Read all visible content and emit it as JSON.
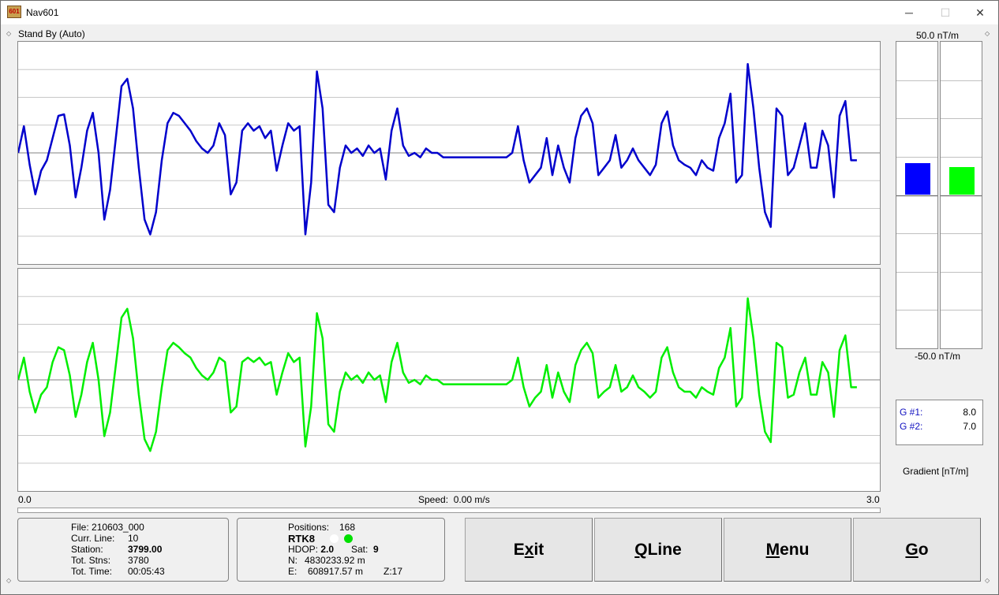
{
  "window": {
    "title": "Nav601",
    "icon": "nav601-app-icon",
    "icon_text": "601",
    "controls": {
      "minimize": "─",
      "maximize": "☐",
      "close": "✕"
    }
  },
  "status": {
    "mode": "Stand By (Auto)"
  },
  "x_axis": {
    "left": "0.0",
    "right": "3.0"
  },
  "speed": {
    "label": "Speed:",
    "value": "0.00 m/s"
  },
  "progress": {
    "fraction": 0
  },
  "gauges": {
    "top_label": "50.0 nT/m",
    "bottom_label": "-50.0 nT/m",
    "g1": {
      "color": "#0000ff",
      "value": 8.0
    },
    "g2": {
      "color": "#00ff00",
      "value": 7.0
    }
  },
  "readout": {
    "g1_label": "G #1:",
    "g1_value": "8.0",
    "g2_label": "G #2:",
    "g2_value": "7.0"
  },
  "gradient_label": "Gradient [nT/m]",
  "file_panel": {
    "file_label": "File:",
    "file_value": "210603_000",
    "line_label": "Curr. Line:",
    "line_value": "10",
    "station_label": "Station:",
    "station_value": "3799.00",
    "stns_label": "Tot. Stns:",
    "stns_value": "3780",
    "time_label": "Tot. Time:",
    "time_value": "00:05:43"
  },
  "gps_panel": {
    "positions_label": "Positions:",
    "positions_value": "168",
    "fix": "RTK8",
    "status_dots": [
      "#ffffff",
      "#00e000"
    ],
    "hdop_label": "HDOP:",
    "hdop_value": "2.0",
    "sat_label": "Sat:",
    "sat_value": "9",
    "n_label": "N:",
    "n_value": "4830233.92 m",
    "e_label": "E:",
    "e_value": "608917.57 m",
    "z_value": "Z:17"
  },
  "buttons": [
    {
      "pre": "E",
      "key": "x",
      "post": "it"
    },
    {
      "pre": "",
      "key": "Q",
      "post": "Line"
    },
    {
      "pre": "",
      "key": "M",
      "post": "enu"
    },
    {
      "pre": "",
      "key": "G",
      "post": "o"
    }
  ],
  "colors": {
    "trace1": "#0000cc",
    "trace2": "#00ee00"
  },
  "chart_data": [
    {
      "type": "line",
      "name": "gradiometer-1-trace",
      "x": [
        0,
        0.02,
        0.04,
        0.06,
        0.08,
        0.1,
        0.12,
        0.14,
        0.16,
        0.18,
        0.2,
        0.22,
        0.24,
        0.26,
        0.28,
        0.3,
        0.32,
        0.34,
        0.36,
        0.38,
        0.4,
        0.42,
        0.44,
        0.46,
        0.48,
        0.5,
        0.52,
        0.54,
        0.56,
        0.58,
        0.6,
        0.62,
        0.64,
        0.66,
        0.68,
        0.7,
        0.72,
        0.74,
        0.76,
        0.78,
        0.8,
        0.82,
        0.84,
        0.86,
        0.88,
        0.9,
        0.92,
        0.94,
        0.96,
        0.98,
        1.0,
        1.02,
        1.04,
        1.06,
        1.08,
        1.1,
        1.12,
        1.14,
        1.16,
        1.18,
        1.2,
        1.22,
        1.24,
        1.26,
        1.28,
        1.3,
        1.32,
        1.34,
        1.36,
        1.38,
        1.4,
        1.42,
        1.44,
        1.46,
        1.48,
        1.5,
        1.52,
        1.54,
        1.56,
        1.58,
        1.6,
        1.62,
        1.64,
        1.66,
        1.68,
        1.7,
        1.72,
        1.74,
        1.76,
        1.78,
        1.8,
        1.82,
        1.84,
        1.86,
        1.88,
        1.9,
        1.92,
        1.94,
        1.96,
        1.98,
        2.0,
        2.02,
        2.04,
        2.06,
        2.08,
        2.1,
        2.12,
        2.14,
        2.16,
        2.18,
        2.2,
        2.22,
        2.24,
        2.26,
        2.28,
        2.3,
        2.32,
        2.34,
        2.36,
        2.38,
        2.4,
        2.42,
        2.44,
        2.46,
        2.48,
        2.5,
        2.52,
        2.54,
        2.56,
        2.58,
        2.6,
        2.62,
        2.64,
        2.66,
        2.68,
        2.7,
        2.72,
        2.74,
        2.76,
        2.78,
        2.8,
        2.82,
        2.84,
        2.86,
        2.88,
        2.9,
        2.92,
        2.94,
        2.96,
        2.98,
        3.0
      ],
      "y": [
        0,
        18,
        -8,
        -28,
        -12,
        -5,
        10,
        25,
        26,
        5,
        -30,
        -10,
        15,
        27,
        0,
        -45,
        -25,
        10,
        45,
        50,
        30,
        -10,
        -45,
        -55,
        -40,
        -5,
        20,
        27,
        25,
        20,
        15,
        8,
        3,
        0,
        5,
        20,
        12,
        -28,
        -20,
        15,
        20,
        15,
        18,
        10,
        15,
        -12,
        5,
        20,
        15,
        18,
        -55,
        -20,
        55,
        30,
        -35,
        -40,
        -10,
        5,
        0,
        3,
        -2,
        5,
        0,
        3,
        -18,
        15,
        30,
        5,
        -2,
        0,
        -3,
        3,
        0,
        0,
        -3,
        -3,
        -3,
        -3,
        -3,
        -3,
        -3,
        -3,
        -3,
        -3,
        -3,
        -3,
        0,
        18,
        -5,
        -20,
        -15,
        -10,
        10,
        -15,
        5,
        -10,
        -20,
        10,
        25,
        30,
        20,
        -15,
        -10,
        -5,
        12,
        -10,
        -5,
        3,
        -5,
        -10,
        -15,
        -8,
        20,
        28,
        5,
        -5,
        -8,
        -10,
        -15,
        -5,
        -10,
        -12,
        10,
        20,
        40,
        -20,
        -15,
        60,
        30,
        -10,
        -40,
        -50,
        30,
        25,
        -15,
        -10,
        5,
        20,
        -10,
        -10,
        15,
        5,
        -30,
        25,
        35,
        -5,
        -5
      ],
      "ylim": [
        -75,
        75
      ]
    },
    {
      "type": "line",
      "name": "gradiometer-2-trace",
      "x": [
        0,
        0.02,
        0.04,
        0.06,
        0.08,
        0.1,
        0.12,
        0.14,
        0.16,
        0.18,
        0.2,
        0.22,
        0.24,
        0.26,
        0.28,
        0.3,
        0.32,
        0.34,
        0.36,
        0.38,
        0.4,
        0.42,
        0.44,
        0.46,
        0.48,
        0.5,
        0.52,
        0.54,
        0.56,
        0.58,
        0.6,
        0.62,
        0.64,
        0.66,
        0.68,
        0.7,
        0.72,
        0.74,
        0.76,
        0.78,
        0.8,
        0.82,
        0.84,
        0.86,
        0.88,
        0.9,
        0.92,
        0.94,
        0.96,
        0.98,
        1.0,
        1.02,
        1.04,
        1.06,
        1.08,
        1.1,
        1.12,
        1.14,
        1.16,
        1.18,
        1.2,
        1.22,
        1.24,
        1.26,
        1.28,
        1.3,
        1.32,
        1.34,
        1.36,
        1.38,
        1.4,
        1.42,
        1.44,
        1.46,
        1.48,
        1.5,
        1.52,
        1.54,
        1.56,
        1.58,
        1.6,
        1.62,
        1.64,
        1.66,
        1.68,
        1.7,
        1.72,
        1.74,
        1.76,
        1.78,
        1.8,
        1.82,
        1.84,
        1.86,
        1.88,
        1.9,
        1.92,
        1.94,
        1.96,
        1.98,
        2.0,
        2.02,
        2.04,
        2.06,
        2.08,
        2.1,
        2.12,
        2.14,
        2.16,
        2.18,
        2.2,
        2.22,
        2.24,
        2.26,
        2.28,
        2.3,
        2.32,
        2.34,
        2.36,
        2.38,
        2.4,
        2.42,
        2.44,
        2.46,
        2.48,
        2.5,
        2.52,
        2.54,
        2.56,
        2.58,
        2.6,
        2.62,
        2.64,
        2.66,
        2.68,
        2.7,
        2.72,
        2.74,
        2.76,
        2.78,
        2.8,
        2.82,
        2.84,
        2.86,
        2.88,
        2.9,
        2.92,
        2.94,
        2.96,
        2.98,
        3.0
      ],
      "y": [
        0,
        15,
        -8,
        -22,
        -10,
        -5,
        12,
        22,
        20,
        3,
        -25,
        -10,
        12,
        25,
        0,
        -38,
        -22,
        10,
        42,
        48,
        28,
        -10,
        -40,
        -48,
        -35,
        -5,
        20,
        25,
        22,
        18,
        15,
        8,
        3,
        0,
        5,
        15,
        12,
        -22,
        -18,
        12,
        15,
        12,
        15,
        10,
        12,
        -10,
        5,
        18,
        12,
        15,
        -45,
        -18,
        45,
        28,
        -30,
        -35,
        -8,
        5,
        0,
        3,
        -2,
        5,
        0,
        3,
        -15,
        12,
        25,
        5,
        -2,
        0,
        -3,
        3,
        0,
        0,
        -3,
        -3,
        -3,
        -3,
        -3,
        -3,
        -3,
        -3,
        -3,
        -3,
        -3,
        -3,
        0,
        15,
        -5,
        -18,
        -12,
        -8,
        10,
        -12,
        5,
        -8,
        -15,
        10,
        20,
        25,
        18,
        -12,
        -8,
        -5,
        10,
        -8,
        -5,
        3,
        -5,
        -8,
        -12,
        -8,
        15,
        22,
        5,
        -5,
        -8,
        -8,
        -12,
        -5,
        -8,
        -10,
        8,
        15,
        35,
        -18,
        -12,
        55,
        28,
        -10,
        -35,
        -42,
        25,
        22,
        -12,
        -10,
        5,
        15,
        -10,
        -10,
        12,
        5,
        -25,
        20,
        30,
        -5,
        -5
      ],
      "ylim": [
        -75,
        75
      ]
    }
  ]
}
